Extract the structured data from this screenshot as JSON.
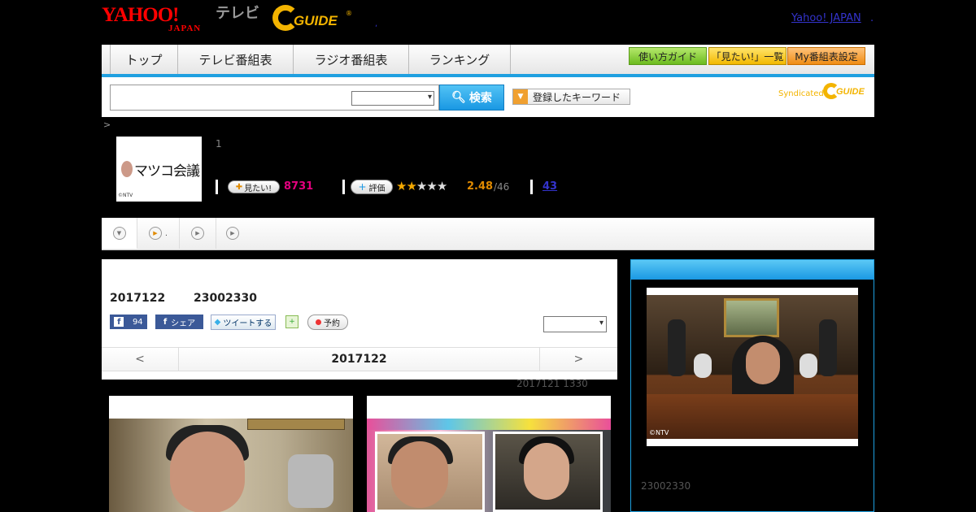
{
  "header": {
    "yahoo_logo": "YAHOO!",
    "yahoo_logo_sub": "JAPAN",
    "tv_label": "テレビ",
    "gguide_logo": "GUIDE",
    "separator": ",",
    "yahoo_japan_link": "Yahoo! JAPAN",
    "trailing": "."
  },
  "nav": {
    "tabs": [
      "トップ",
      "テレビ番組表",
      "ラジオ番組表",
      "ランキング"
    ],
    "buttons": [
      "使い方ガイド",
      "「見たい!」一覧",
      "My番組表設定"
    ]
  },
  "search": {
    "input_value": "",
    "select_value": "",
    "search_button": "検索",
    "keyword_button": "登録したキーワード",
    "syndicated": "Syndicated"
  },
  "breadcrumb": ">",
  "program": {
    "thumb_title": "マツコ会議",
    "thumb_copyright": "©NTV",
    "number": "1",
    "mitai_label": "見たい!",
    "mitai_count": "8731",
    "rating_label": "評価",
    "stars_filled": 2,
    "stars_total": 5,
    "score": "2.48",
    "score_denominator": "/46",
    "review_count": "43"
  },
  "subtabs": [
    {
      "icon": "down-arrow-icon",
      "label": ""
    },
    {
      "icon": "play-icon",
      "label": "."
    },
    {
      "icon": "play-icon",
      "label": ""
    },
    {
      "icon": "play-icon",
      "label": ""
    }
  ],
  "main": {
    "date": "2017122",
    "time": "23002330",
    "fb_count": "94",
    "share_label": "シェア",
    "tweet_label": "ツイートする",
    "reserve_label": "予約",
    "date_nav": {
      "prev": "<",
      "current": "2017122",
      "next": ">"
    },
    "updated": "2017121  1330"
  },
  "right_panel": {
    "photo_copyright": "©NTV",
    "time": "23002330"
  },
  "colors": {
    "accent_blue": "#1fa0e0",
    "mitai_pink": "#e4007f",
    "score_orange": "#e08a00",
    "link_blue": "#3333cc",
    "yahoo_red": "#ff0000",
    "gguide_yellow": "#f3b400"
  }
}
